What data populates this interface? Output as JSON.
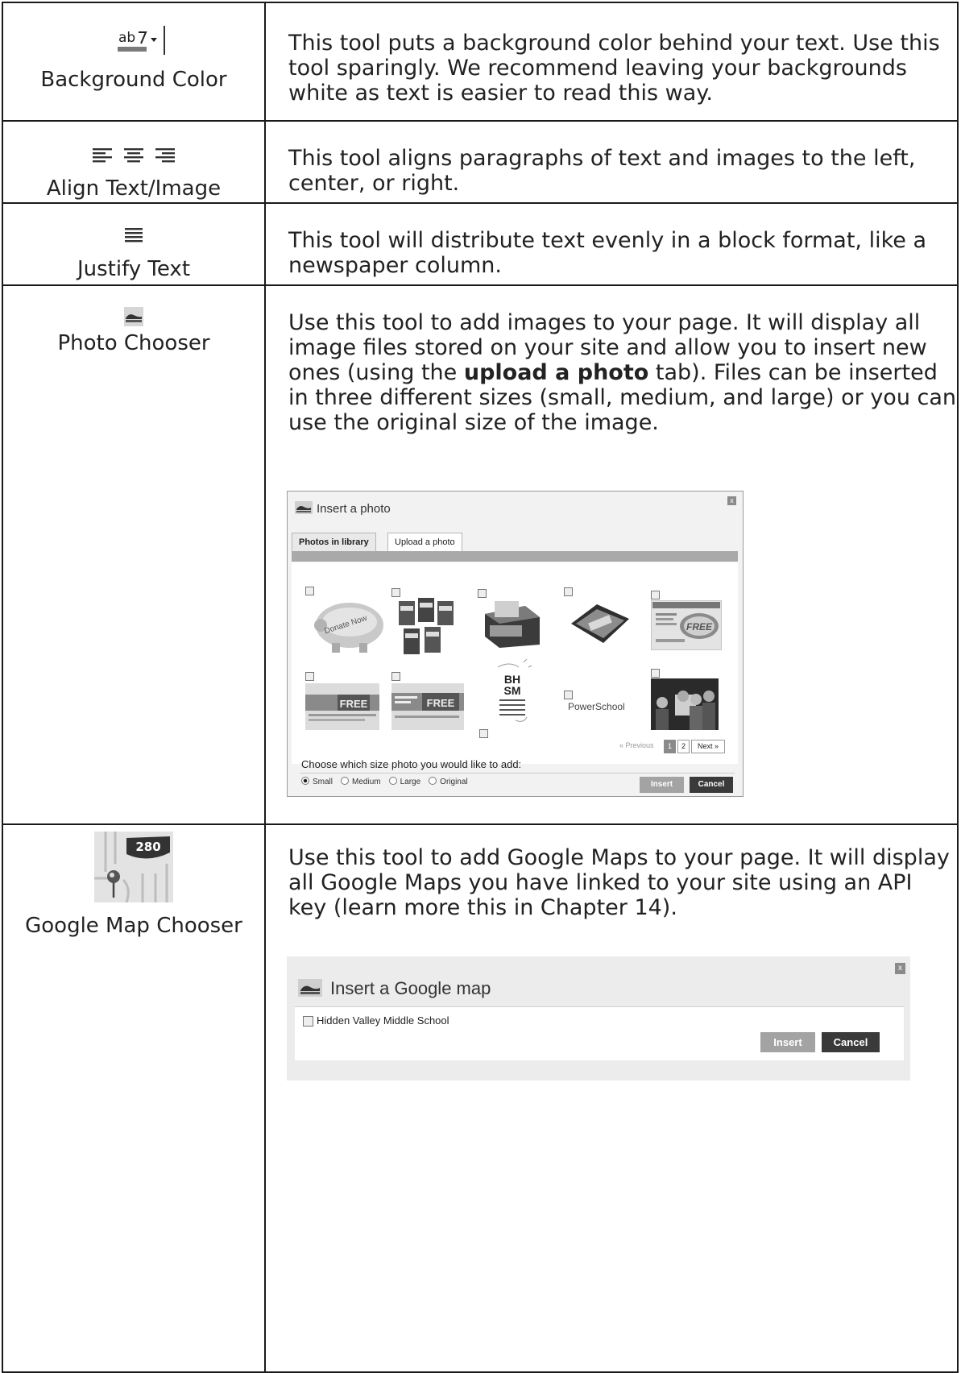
{
  "tools": [
    {
      "name": "Background Color",
      "icon": "background-color-icon",
      "icon_text": "ab",
      "description": "This tool puts a background color behind your text. Use this tool sparingly. We recommend leaving your backgrounds white as text is easier to read this way."
    },
    {
      "name": "Align Text/Image",
      "icon": "align-left-center-right-icons",
      "description": "This tool aligns paragraphs of text and images to the left, center, or right."
    },
    {
      "name": "Justify Text",
      "icon": "justify-icon",
      "description": "This tool will distribute text evenly in a block format, like a newspaper column."
    },
    {
      "name": "Photo Chooser",
      "icon": "photo-icon",
      "description_before": "Use this tool to add images to your page. It will display all image files stored on your site and allow you to insert new ones (using the ",
      "description_bold": "upload a photo",
      "description_after": " tab). Files can be inserted in three different sizes (small, medium, and large) or you can use the original size of the image."
    },
    {
      "name": "Google Map Chooser",
      "icon": "map-280-icon",
      "icon_text": "280",
      "description": "Use this tool to add Google Maps to your page. It will display all Google Maps you have linked to your site using an API key (learn more this in Chapter 14)."
    }
  ],
  "photo_dialog": {
    "title": "Insert a photo",
    "close": "x",
    "tabs": [
      "Photos in library",
      "Upload a photo"
    ],
    "thumb_labels": {
      "piggy": "Donate Now",
      "bhsm_1": "BH",
      "bhsm_2": "SM",
      "free": "FREE",
      "powerschool": "PowerSchool"
    },
    "pager": {
      "previous": "« Previous",
      "pages": [
        "1",
        "2"
      ],
      "next": "Next »"
    },
    "size_prompt": "Choose which size photo you would like to add:",
    "sizes": [
      "Small",
      "Medium",
      "Large",
      "Original"
    ],
    "selected_size": "Small",
    "insert": "Insert",
    "cancel": "Cancel"
  },
  "map_dialog": {
    "title": "Insert a Google map",
    "close": "x",
    "items": [
      "Hidden Valley Middle School"
    ],
    "insert": "Insert",
    "cancel": "Cancel"
  }
}
